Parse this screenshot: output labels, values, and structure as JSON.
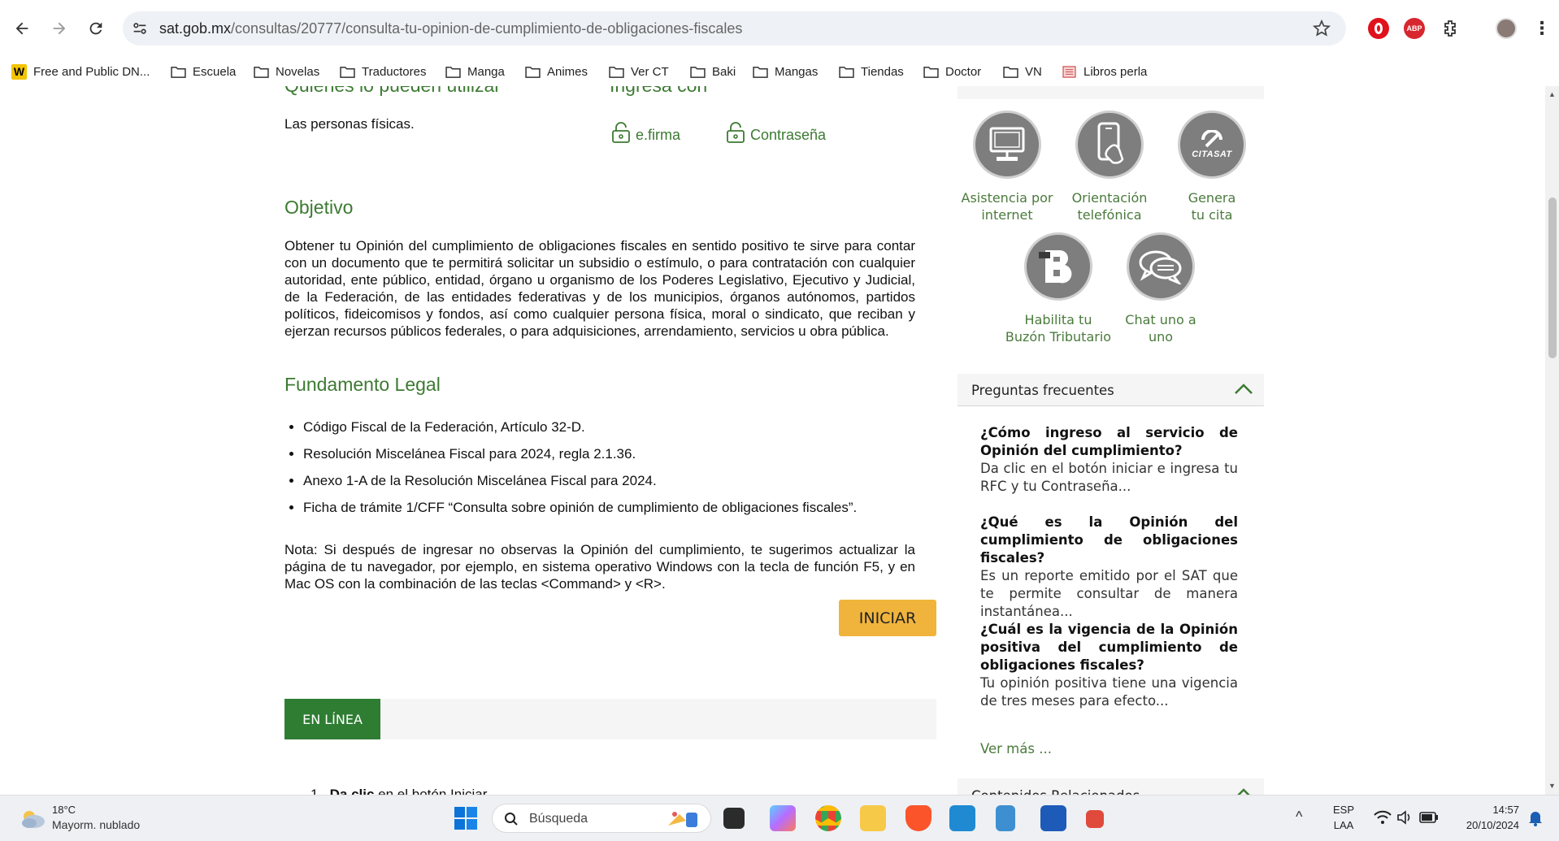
{
  "browser": {
    "url_domain": "sat.gob.mx",
    "url_path": "/consultas/20777/consulta-tu-opinion-de-cumplimiento-de-obligaciones-fiscales",
    "extensions": {
      "abp": "ABP"
    }
  },
  "bookmarks": [
    "Free and Public DN...",
    "Escuela",
    "Novelas",
    "Traductores",
    "Manga",
    "Animes",
    "Ver CT",
    "Baki",
    "Mangas",
    "Tiendas",
    "Doctor",
    "VN",
    "Libros perla"
  ],
  "main": {
    "quienes_heading": "Quiénes lo pueden utilizar",
    "quienes_text": "Las personas físicas.",
    "ingresa_heading": "Ingresa con",
    "efirma": "e.firma",
    "contrasena": "Contraseña",
    "objetivo_heading": "Objetivo",
    "objetivo_text": "Obtener tu Opinión del cumplimiento de obligaciones fiscales  en sentido positivo te sirve para contar con un documento que te permitirá solicitar un subsidio o estímulo, o para contratación con cualquier autoridad, ente público, entidad, órgano u organismo de los Poderes Legislativo, Ejecutivo y Judicial, de la Federación, de las entidades federativas y de los municipios, órganos autónomos, partidos políticos, fideicomisos y fondos, así como cualquier persona física, moral o sindicato, que reciban y ejerzan recursos públicos federales, o para adquisiciones, arrendamiento, servicios u obra pública.",
    "fundamento_heading": "Fundamento Legal",
    "fundamento_items": [
      "Código Fiscal de la Federación, Artículo 32-D.",
      "Resolución Miscelánea Fiscal para 2024, regla 2.1.36.",
      "Anexo 1-A de la Resolución Miscelánea Fiscal para 2024.",
      "Ficha de trámite 1/CFF “Consulta sobre opinión de cumplimiento de obligaciones fiscales”."
    ],
    "nota_text": "Nota: Si después de ingresar no observas la Opinión del cumplimiento, te sugerimos actualizar la página de tu navegador, por ejemplo, en sistema operativo Windows con la tecla de función F5, y en Mac OS con la combinación de las teclas <Command> y <R>.",
    "iniciar_label": "INICIAR",
    "tab_en_linea": "EN LÍNEA",
    "step_bold": "Da clic",
    "step_rest": " en el botón Iniciar."
  },
  "sidebar": {
    "buttons": [
      {
        "label_1": "Asistencia por",
        "label_2": "internet"
      },
      {
        "label_1": "Orientación",
        "label_2": "telefónica"
      },
      {
        "label_1": "Genera",
        "label_2": "tu cita",
        "logo_text": "CITASAT"
      },
      {
        "label_1": "Habilita tu",
        "label_2": "Buzón Tributario"
      },
      {
        "label_1": "Chat uno a",
        "label_2": "uno"
      }
    ],
    "faq_title": "Preguntas frecuentes",
    "faq": [
      {
        "q": "¿Cómo ingreso al servicio de Opinión del cumplimiento?",
        "a": "Da clic en el botón iniciar e ingresa tu RFC y tu Contraseña..."
      },
      {
        "q": "¿Qué es la Opinión del cumplimiento de obligaciones fiscales?",
        "a": "Es un reporte emitido por el SAT que te permite consultar de manera instantánea..."
      },
      {
        "q": "¿Cuál es la vigencia de la Opinión positiva del cumplimiento de obligaciones fiscales?",
        "a": "Tu opinión positiva tiene una vigencia de tres meses para efecto..."
      }
    ],
    "ver_mas": "Ver más ...",
    "related_title": "Contenidos Relacionados"
  },
  "taskbar": {
    "temp": "18°C",
    "weather": "Mayorm. nublado",
    "search_placeholder": "Búsqueda",
    "lang_1": "ESP",
    "lang_2": "LAA",
    "time": "14:57",
    "date": "20/10/2024"
  },
  "colors": {
    "green_heading": "#3c7a32",
    "iniciar_bg": "#f0b43c",
    "tab_bg": "#2e7d32",
    "icon_gray": "#7e7e7e"
  }
}
